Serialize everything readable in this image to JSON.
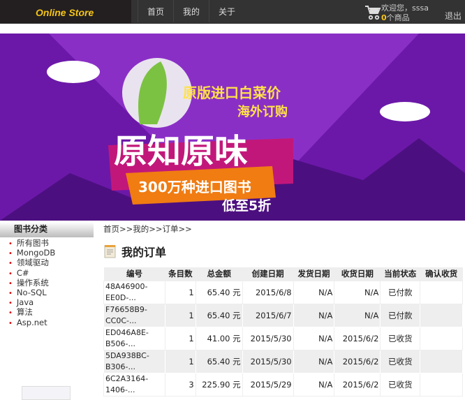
{
  "nav": {
    "logo": "Online Store",
    "links": [
      "首页",
      "我的",
      "关于"
    ],
    "welcome": "欢迎您，sssa",
    "cart_count": "0",
    "cart_suffix": "个商品",
    "logout": "退出"
  },
  "banner": {
    "line1": "原版进口白菜价",
    "line2": "海外订购",
    "main": "原知原味",
    "line3": "300万种进口图书",
    "line4": "低至5折"
  },
  "sidebar": {
    "title": "图书分类",
    "items": [
      "所有图书",
      "MongoDB",
      "领域驱动",
      "C#",
      "操作系统",
      "No-SQL",
      "Java",
      "算法",
      "Asp.net"
    ]
  },
  "breadcrumb": "首页>>我的>>订单>>",
  "page_title": "我的订单",
  "table": {
    "headers": [
      "编号",
      "条目数",
      "总金额",
      "创建日期",
      "发货日期",
      "收货日期",
      "当前状态",
      "确认收货"
    ],
    "rows": [
      [
        "48A46900-\nEE0D-...",
        "1",
        "65.40 元",
        "2015/6/8",
        "N/A",
        "N/A",
        "已付款",
        ""
      ],
      [
        "F76658B9-\nCC0C-...",
        "1",
        "65.40 元",
        "2015/6/7",
        "N/A",
        "N/A",
        "已付款",
        ""
      ],
      [
        "ED046A8E-\nB506-...",
        "1",
        "41.00 元",
        "2015/5/30",
        "N/A",
        "2015/6/2",
        "已收货",
        ""
      ],
      [
        "5DA938BC-\nB306-...",
        "1",
        "65.40 元",
        "2015/5/30",
        "N/A",
        "2015/6/2",
        "已收货",
        ""
      ],
      [
        "6C2A3164-\n1406-...",
        "3",
        "225.90 元",
        "2015/5/29",
        "N/A",
        "2015/6/2",
        "已收货",
        ""
      ]
    ]
  }
}
